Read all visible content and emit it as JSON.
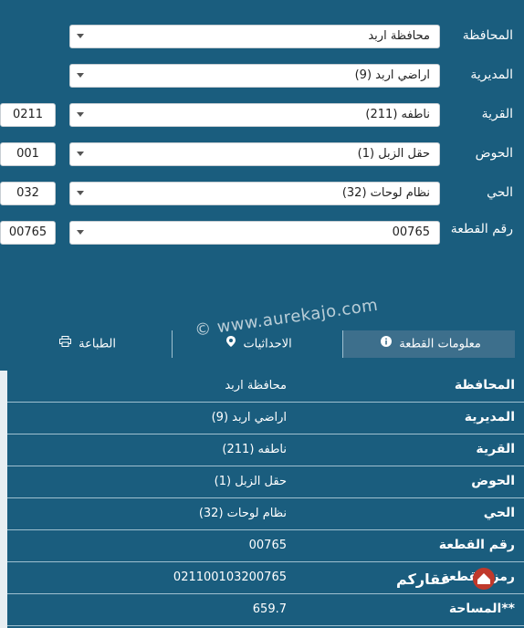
{
  "form": {
    "rows": [
      {
        "label": "المحافظة",
        "value": "محافظة اربد",
        "code": ""
      },
      {
        "label": "المديرية",
        "value": "اراضي اربد (9)",
        "code": ""
      },
      {
        "label": "القرية",
        "value": "ناطفه (211)",
        "code": "0211"
      },
      {
        "label": "الحوض",
        "value": "حقل الزبل (1)",
        "code": "001"
      },
      {
        "label": "الحي",
        "value": "نظام لوحات (32)",
        "code": "032"
      },
      {
        "label": "رقم القطعة",
        "value": "00765",
        "code": "00765"
      }
    ]
  },
  "tabs": {
    "info": "معلومات القطعة",
    "coords": "الاحداثيات",
    "print": "الطباعة"
  },
  "table": {
    "rows": [
      {
        "label": "المحافظة",
        "value": "محافظة اربد"
      },
      {
        "label": "المديرية",
        "value": "اراضي اربد (9)"
      },
      {
        "label": "القرية",
        "value": "ناطفه (211)"
      },
      {
        "label": "الحوض",
        "value": "حقل الزبل (1)"
      },
      {
        "label": "الحي",
        "value": "نظام لوحات (32)"
      },
      {
        "label": "رقم القطعة",
        "value": "00765"
      },
      {
        "label": "رمز القطعة",
        "value": "02110010320076‌5"
      },
      {
        "label": "المساحة**",
        "value": "659.7"
      }
    ]
  },
  "watermark": "© www.aurekajo.com",
  "logo_text": "عقاركم",
  "colors": {
    "background": "#1a5d7e",
    "active_tab": "#3d6f8c",
    "logo_red": "#c0392b"
  }
}
